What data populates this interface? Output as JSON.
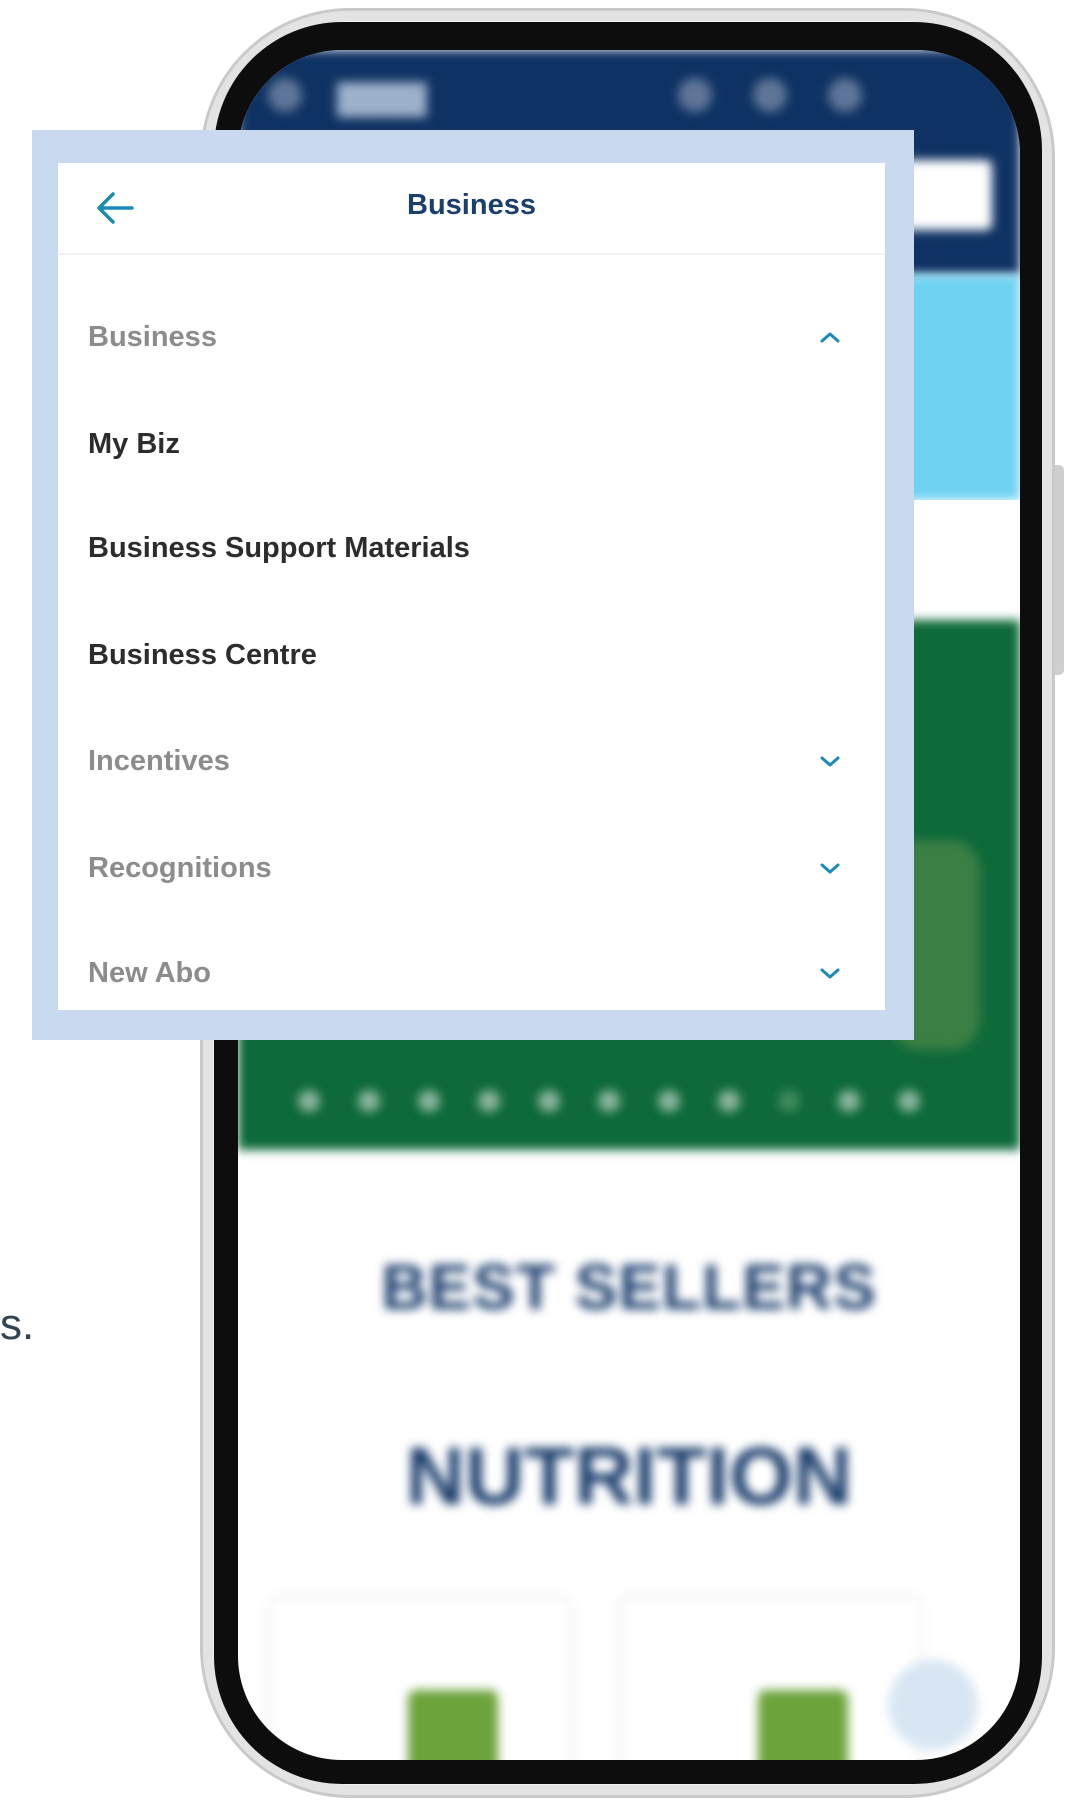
{
  "panel": {
    "title": "Business"
  },
  "menu": {
    "sections": [
      {
        "label": "Business",
        "expanded": true
      },
      {
        "label": "Incentives",
        "expanded": false
      },
      {
        "label": "Recognitions",
        "expanded": false
      },
      {
        "label": "New Abo",
        "expanded": false
      }
    ],
    "items": [
      {
        "label": "My Biz"
      },
      {
        "label": "Business Support Materials"
      },
      {
        "label": "Business Centre"
      }
    ]
  },
  "background": {
    "best_sellers": "BEST SELLERS",
    "nutrition": "NUTRITION"
  },
  "side_text": "s.",
  "colors": {
    "accent": "#1a8ab8",
    "title": "#1a3e6e",
    "header_navy": "#0f3264",
    "banner_green": "#0e6a3a",
    "frame": "#c9daf0"
  }
}
